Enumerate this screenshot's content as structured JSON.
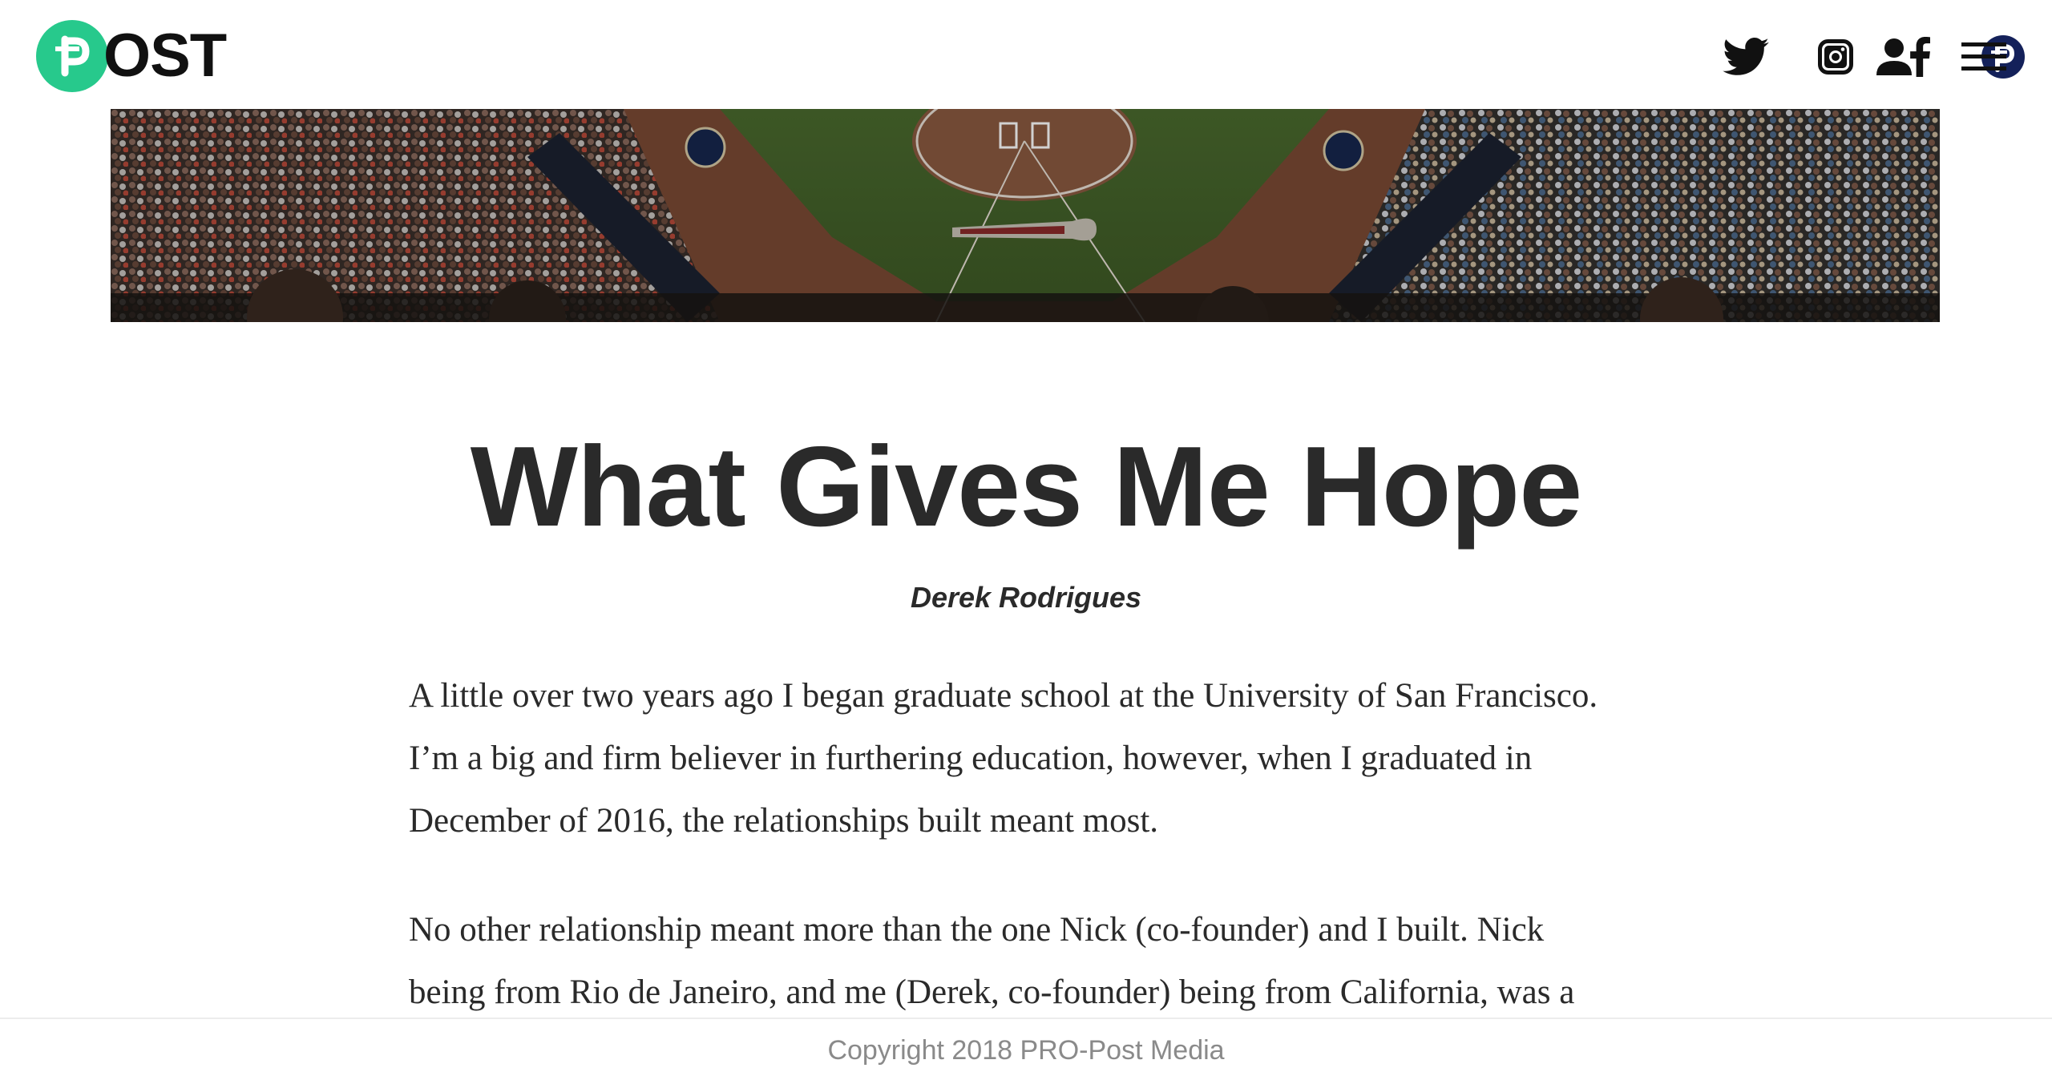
{
  "header": {
    "logo_text": "OST",
    "logo_color": "#27c98c",
    "icons": [
      "twitter-icon",
      "instagram-icon",
      "facebook-icon",
      "pro-post-icon",
      "user-icon",
      "menu-icon"
    ]
  },
  "hero": {
    "image": "baseball stadium at dusk with crowd in the stands"
  },
  "article": {
    "title": "What Gives Me Hope",
    "author": "Derek Rodrigues",
    "paragraphs": [
      [
        "A little over two years ago I began graduate school at the University of San Francisco.",
        "I’m a big and firm believer in furthering education, however, when I graduated in",
        "December of 2016, the relationships built meant most."
      ],
      [
        "No other relationship meant more than the one Nick (co-founder) and I built. Nick",
        "being from Rio de Janeiro, and me (Derek, co-founder) being from California, was a"
      ]
    ]
  },
  "footer": {
    "copyright": "Copyright 2018 PRO-Post Media"
  }
}
